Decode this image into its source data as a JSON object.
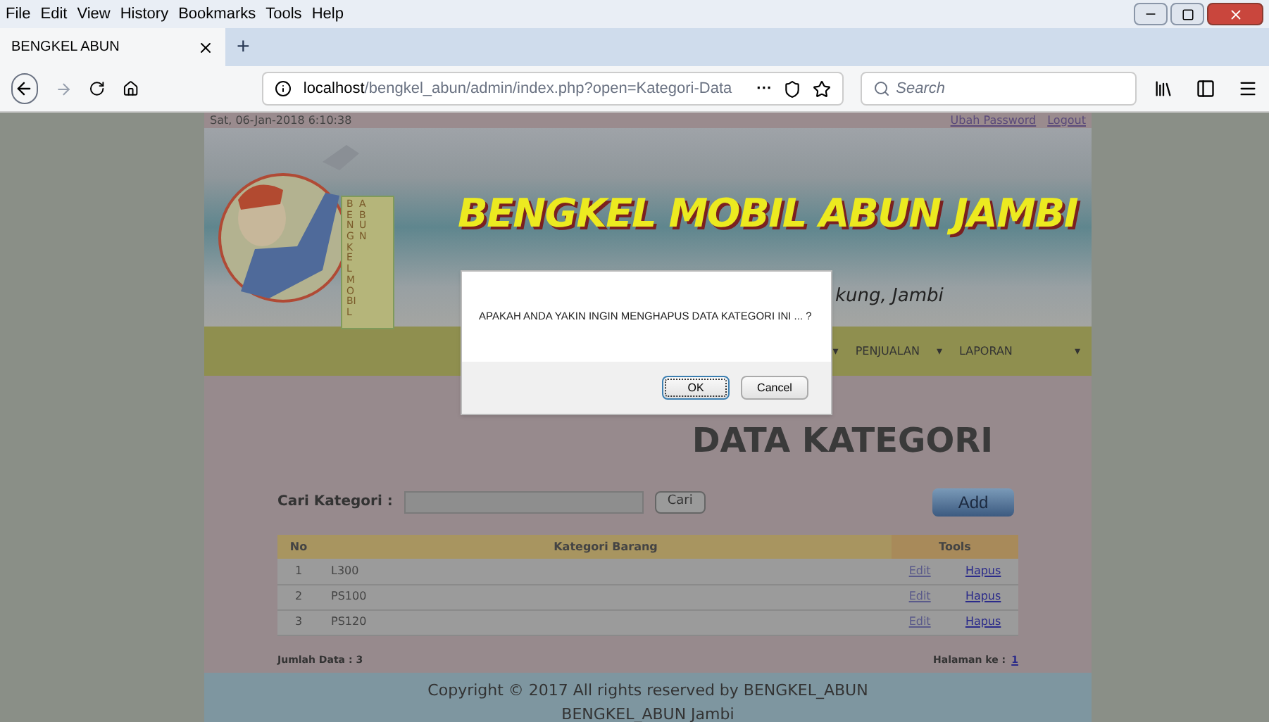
{
  "browser": {
    "menu": [
      "File",
      "Edit",
      "View",
      "History",
      "Bookmarks",
      "Tools",
      "Help"
    ],
    "tabs": [
      {
        "label": "BENGKEL ABUN",
        "selected": true
      }
    ],
    "new_tab": "+",
    "url_host": "localhost",
    "url_path": "/bengkel_abun/admin/index.php?open=Kategori-Data",
    "more": "···",
    "search": {
      "placeholder": "Search"
    }
  },
  "top_strip": {
    "datetime": "Sat, 06-Jan-2018 6:10:38",
    "links": [
      "Ubah Password",
      "Logout"
    ]
  },
  "banner": {
    "title": "BENGKEL MOBIL ABUN JAMBI",
    "subtitle": "kung, Jambi",
    "sign_lines": [
      "BENGKEL MOBIL",
      "ABUN"
    ]
  },
  "menu": {
    "items": [
      "PENJUALAN",
      "LAPORAN"
    ],
    "caret": "▾"
  },
  "heading": "DATA KATEGORI",
  "search_row": {
    "label": "Cari Kategori :",
    "button": "Cari",
    "add": "Add"
  },
  "table": {
    "columns": [
      "No",
      "Kategori Barang",
      "Tools"
    ],
    "rows": [
      {
        "no": "1",
        "name": "L300",
        "edit": "Edit",
        "delete": "Hapus"
      },
      {
        "no": "2",
        "name": "PS100",
        "edit": "Edit",
        "delete": "Hapus"
      },
      {
        "no": "3",
        "name": "PS120",
        "edit": "Edit",
        "delete": "Hapus"
      }
    ]
  },
  "summary": {
    "count": "Jumlah Data : 3",
    "page_label": "Halaman ke :",
    "page": "1"
  },
  "footer": [
    "Copyright © 2017 All rights reserved by BENGKEL_ABUN",
    "BENGKEL_ABUN Jambi"
  ],
  "dialog": {
    "message": "APAKAH ANDA YAKIN INGIN MENGHAPUS DATA KATEGORI INI ... ?",
    "buttons": [
      {
        "label": "OK",
        "selected": true
      },
      {
        "label": "Cancel",
        "selected": false
      }
    ]
  }
}
